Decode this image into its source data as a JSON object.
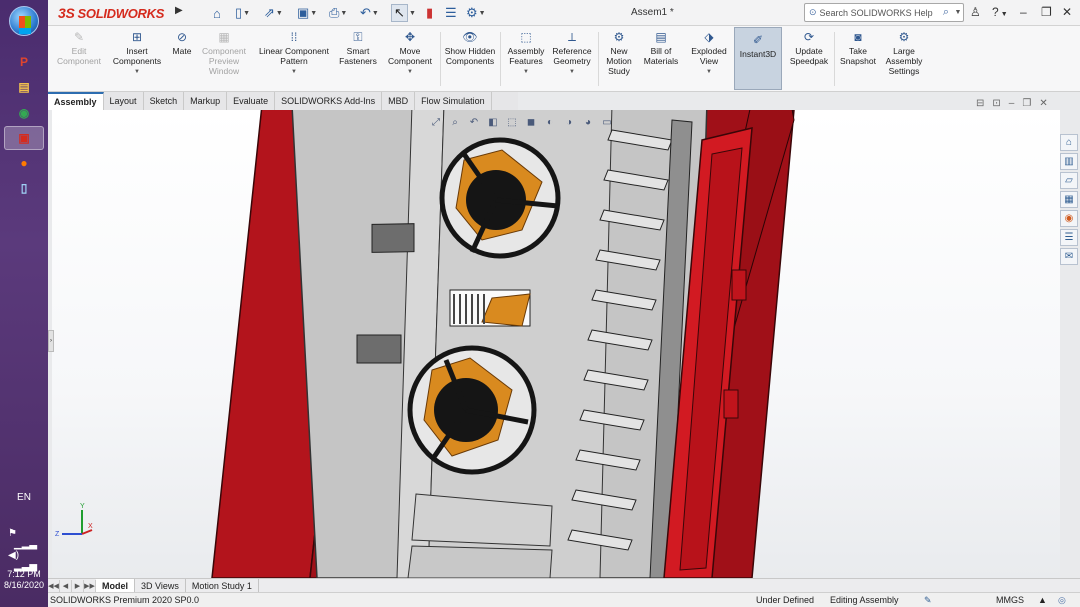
{
  "taskbar": {
    "language": "EN",
    "time": "7:12 PM",
    "date": "8/16/2020",
    "apps": [
      {
        "icon": "p-icon",
        "glyph": "P",
        "color": "#e0452d"
      },
      {
        "icon": "folder-icon",
        "glyph": "▤",
        "color": "#f2c14e"
      },
      {
        "icon": "chrome-icon",
        "glyph": "◉",
        "color": "#34a853"
      },
      {
        "icon": "solidworks-icon",
        "glyph": "▣",
        "color": "#d52b1e"
      },
      {
        "icon": "firefox-icon",
        "glyph": "●",
        "color": "#ff7b00"
      },
      {
        "icon": "notepad-icon",
        "glyph": "▯",
        "color": "#9fd1f5"
      }
    ]
  },
  "app": {
    "logo_text": "SOLIDWORKS",
    "logo_prefix": "3S",
    "document_title": "Assem1 *",
    "search_placeholder": "Search SOLIDWORKS Help",
    "help": "?",
    "accent": "#d52b1e"
  },
  "ribbon": {
    "edit_component": "Edit Component",
    "insert_components": "Insert Components",
    "mate": "Mate",
    "component_preview": "Component Preview Window",
    "linear_pattern": "Linear Component Pattern",
    "smart_fasteners": "Smart Fasteners",
    "move_component": "Move Component",
    "show_hidden": "Show Hidden Components",
    "assembly_features": "Assembly Features",
    "reference_geometry": "Reference Geometry",
    "new_motion": "New Motion Study",
    "bom": "Bill of Materials",
    "exploded_view": "Exploded View",
    "instant3d": "Instant3D",
    "update_speedpak": "Update Speedpak",
    "take_snapshot": "Take Snapshot",
    "large_assembly": "Large Assembly Settings"
  },
  "tabs": [
    "Assembly",
    "Layout",
    "Sketch",
    "Markup",
    "Evaluate",
    "SOLIDWORKS Add-Ins",
    "MBD",
    "Flow Simulation"
  ],
  "bottom_tabs": [
    "Model",
    "3D Views",
    "Motion Study 1"
  ],
  "status": {
    "product": "SOLIDWORKS Premium 2020 SP0.0",
    "definition": "Under Defined",
    "mode": "Editing Assembly",
    "units": "MMGS"
  },
  "triad": {
    "x": "X",
    "y": "Y",
    "z": "Z"
  },
  "colors": {
    "enclosure_red": "#b3141c",
    "panel_gray": "#c8c8c8",
    "fan_orange": "#d98a1f",
    "fan_black": "#151515"
  }
}
